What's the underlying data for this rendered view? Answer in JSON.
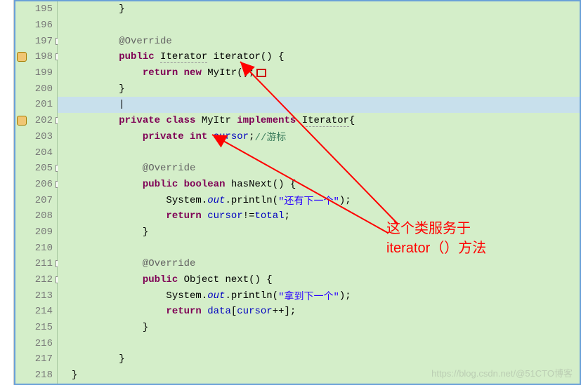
{
  "gutter": {
    "lines": [
      195,
      196,
      197,
      198,
      199,
      200,
      201,
      202,
      203,
      204,
      205,
      206,
      207,
      208,
      209,
      210,
      211,
      212,
      213,
      214,
      215,
      216,
      217,
      218
    ],
    "markers": {
      "198": "warn",
      "202": "warn"
    },
    "folds": [
      197,
      198,
      202,
      205,
      206,
      211,
      212
    ]
  },
  "code": {
    "l195": {
      "indent": "        ",
      "t1": "}"
    },
    "l196": {
      "indent": ""
    },
    "l197": {
      "indent": "        ",
      "ann": "@Override"
    },
    "l198": {
      "indent": "        ",
      "kw1": "public",
      "type": "Iterator",
      "name": "iterator",
      "tail": "() {"
    },
    "l199": {
      "indent": "            ",
      "kw1": "return",
      "kw2": "new",
      "ctor": "MyItr",
      "tail": "();"
    },
    "l200": {
      "indent": "        ",
      "t1": "}"
    },
    "l201": {
      "indent": "        ",
      "caret": "|"
    },
    "l202": {
      "indent": "        ",
      "kw1": "private",
      "kw2": "class",
      "name": "MyItr",
      "kw3": "implements",
      "iface": "Iterator",
      "tail": "{"
    },
    "l203": {
      "indent": "            ",
      "kw1": "private",
      "kw2": "int",
      "name": "cursor",
      "tail": ";",
      "cmt": "//游标"
    },
    "l204": {
      "indent": ""
    },
    "l205": {
      "indent": "            ",
      "ann": "@Override"
    },
    "l206": {
      "indent": "            ",
      "kw1": "public",
      "kw2": "boolean",
      "name": "hasNext",
      "tail": "() {"
    },
    "l207": {
      "indent": "                ",
      "pre": "System.",
      "out": "out",
      "mid": ".println(",
      "str": "\"还有下一个\"",
      "tail": ");"
    },
    "l208": {
      "indent": "                ",
      "kw1": "return",
      "f1": "cursor",
      "op": "!=",
      "f2": "total",
      "tail": ";"
    },
    "l209": {
      "indent": "            ",
      "t1": "}"
    },
    "l210": {
      "indent": ""
    },
    "l211": {
      "indent": "            ",
      "ann": "@Override"
    },
    "l212": {
      "indent": "            ",
      "kw1": "public",
      "type": "Object",
      "name": "next",
      "tail": "() {"
    },
    "l213": {
      "indent": "                ",
      "pre": "System.",
      "out": "out",
      "mid": ".println(",
      "str": "\"拿到下一个\"",
      "tail": ");"
    },
    "l214": {
      "indent": "                ",
      "kw1": "return",
      "f1": "data",
      "mid": "[",
      "f2": "cursor",
      "op": "++];",
      "tail": ""
    },
    "l215": {
      "indent": "            ",
      "t1": "}"
    },
    "l216": {
      "indent": ""
    },
    "l217": {
      "indent": "        ",
      "t1": "}"
    },
    "l218": {
      "indent": "",
      "t1": "}"
    }
  },
  "annotation": {
    "line1": "这个类服务于",
    "line2": "iterator（）方法"
  },
  "watermark": "https://blog.csdn.net/@51CTO博客"
}
